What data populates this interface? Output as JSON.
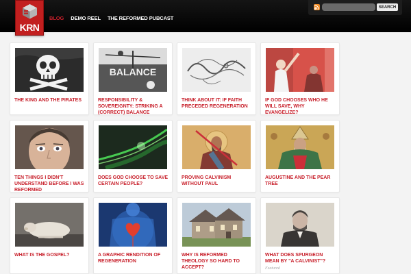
{
  "header": {
    "logo_text": "KRN",
    "nav": [
      {
        "label": "BLOG",
        "active": true
      },
      {
        "label": "DEMO REEL",
        "active": false
      },
      {
        "label": "THE REFORMED PUBCAST",
        "active": false
      }
    ],
    "search": {
      "placeholder": "",
      "button_label": "SEARCH"
    }
  },
  "colors": {
    "accent": "#c8202b",
    "logo_bg": "#c21f1f",
    "topbar": "#0b0b0b",
    "page_bg": "#f3f3f3"
  },
  "posts": [
    {
      "title": "THE KING AND THE PIRATES",
      "image": "skull-flag-image"
    },
    {
      "title": "RESPONSIBILITY & SOVEREIGNTY: STRIKING A (CORRECT) BALANCE",
      "image": "balance-scale-image"
    },
    {
      "title": "THINK ABOUT IT: IF FAITH PRECEDED REGENERATION",
      "image": "faith-calligraphy-image"
    },
    {
      "title": "IF GOD CHOOSES WHO HE WILL SAVE, WHY EVANGELIZE?",
      "image": "street-preacher-image"
    },
    {
      "title": "TEN THINGS I DIDN'T UNDERSTAND BEFORE I WAS REFORMED",
      "image": "man-face-image"
    },
    {
      "title": "DOES GOD CHOOSE TO SAVE CERTAIN PEOPLE?",
      "image": "green-light-image"
    },
    {
      "title": "PROVING CALVINISM WITHOUT PAUL",
      "image": "paul-icon-image"
    },
    {
      "title": "AUGUSTINE AND THE PEAR TREE",
      "image": "augustine-image"
    },
    {
      "title": "WHAT IS THE GOSPEL?",
      "image": "lamb-image"
    },
    {
      "title": "A GRAPHIC RENDITION OF REGENERATION",
      "image": "heart-xray-image"
    },
    {
      "title": "WHY IS REFORMED THEOLOGY SO HARD TO ACCEPT?",
      "image": "house-image"
    },
    {
      "title": "WHAT DOES SPURGEON MEAN BY \"A CALVINIST\"?",
      "image": "spurgeon-portrait-image",
      "tag": "Featured"
    }
  ]
}
